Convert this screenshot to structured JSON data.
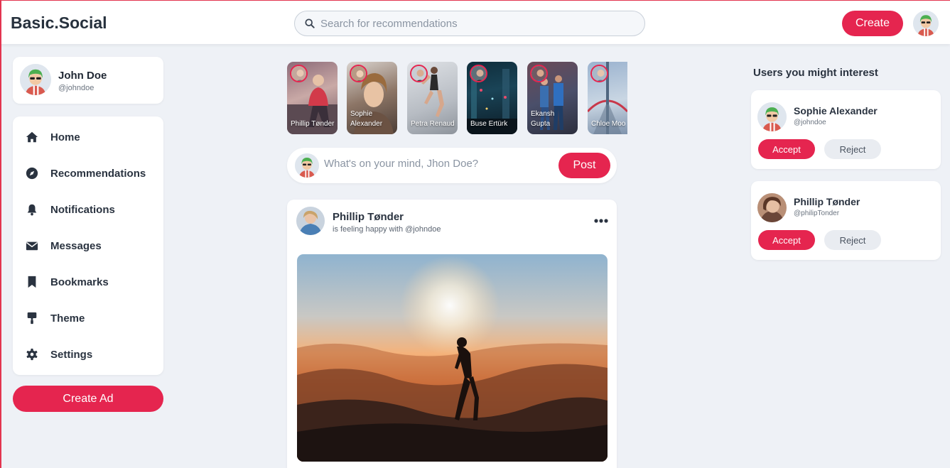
{
  "header": {
    "brand": "Basic.Social",
    "search_placeholder": "Search for recommendations",
    "create_label": "Create"
  },
  "profile": {
    "name": "John Doe",
    "handle": "@johndoe"
  },
  "nav": {
    "items": [
      {
        "label": "Home",
        "icon": "home-icon"
      },
      {
        "label": "Recommendations",
        "icon": "compass-icon"
      },
      {
        "label": "Notifications",
        "icon": "bell-icon"
      },
      {
        "label": "Messages",
        "icon": "envelope-icon"
      },
      {
        "label": "Bookmarks",
        "icon": "bookmark-icon"
      },
      {
        "label": "Theme",
        "icon": "paint-roller-icon"
      },
      {
        "label": "Settings",
        "icon": "gear-icon"
      }
    ]
  },
  "create_ad_label": "Create Ad",
  "stories": [
    {
      "name": "Phillip Tønder"
    },
    {
      "name": "Sophie Alexander"
    },
    {
      "name": "Petra Renaud"
    },
    {
      "name": "Buse Ertürk"
    },
    {
      "name": "Ekansh Gupta"
    },
    {
      "name": "Chloe Moo"
    }
  ],
  "composer": {
    "placeholder": "What's on your mind, Jhon Doe?",
    "post_label": "Post"
  },
  "post": {
    "author": "Phillip Tønder",
    "feeling": "is feeling happy with @johndoe"
  },
  "suggestions": {
    "title": "Users you might interest",
    "users": [
      {
        "name": "Sophie Alexander",
        "handle": "@johndoe",
        "accept_label": "Accept",
        "reject_label": "Reject"
      },
      {
        "name": "Phillip Tønder",
        "handle": "@philipTonder",
        "accept_label": "Accept",
        "reject_label": "Reject"
      }
    ]
  },
  "colors": {
    "accent": "#e5254f",
    "background": "#eef1f6",
    "card": "#ffffff"
  }
}
